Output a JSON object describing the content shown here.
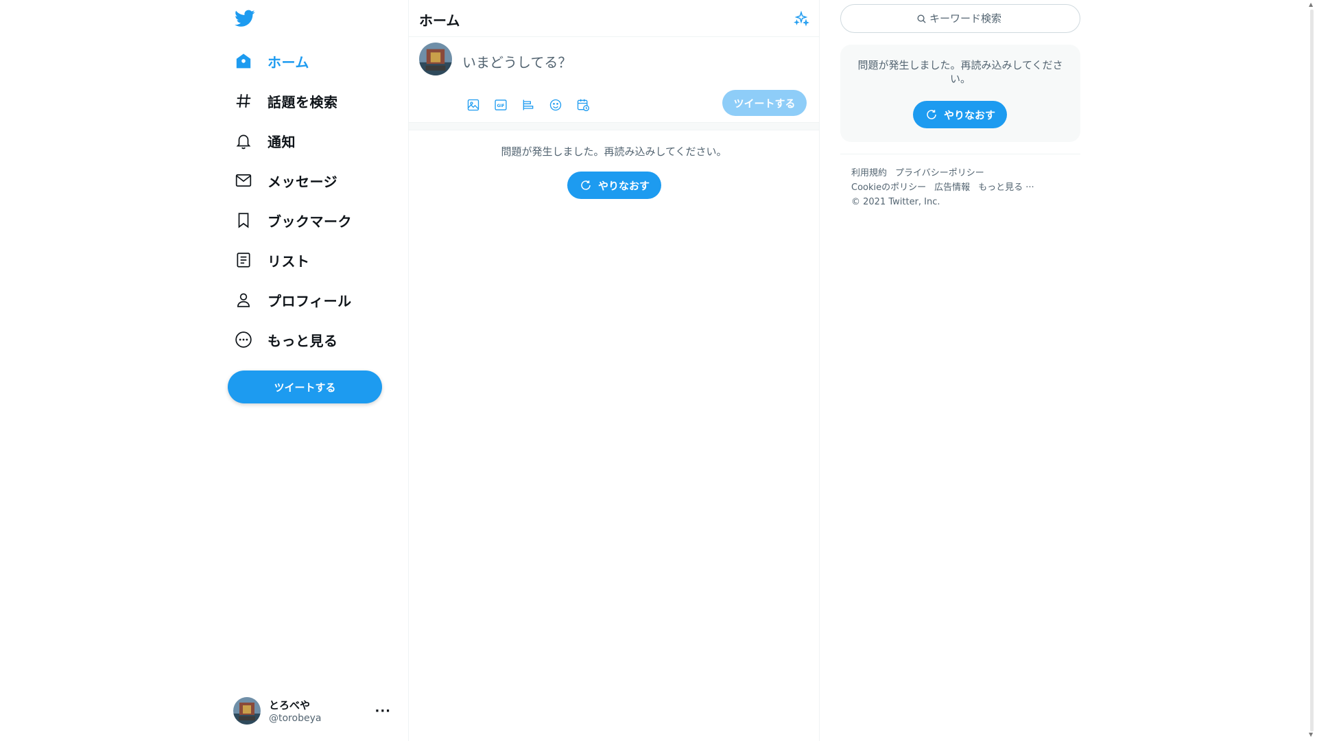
{
  "colors": {
    "accent": "#1d9bf0",
    "accent_disabled": "#8ecdf8",
    "text": "#0f1419",
    "muted": "#536471"
  },
  "sidebar": {
    "logo": "twitter-bird-icon",
    "items": [
      {
        "label": "ホーム",
        "icon": "home-icon",
        "active": true
      },
      {
        "label": "話題を検索",
        "icon": "hashtag-icon"
      },
      {
        "label": "通知",
        "icon": "bell-icon"
      },
      {
        "label": "メッセージ",
        "icon": "mail-icon"
      },
      {
        "label": "ブックマーク",
        "icon": "bookmark-icon"
      },
      {
        "label": "リスト",
        "icon": "list-icon"
      },
      {
        "label": "プロフィール",
        "icon": "person-icon"
      },
      {
        "label": "もっと見る",
        "icon": "more-circle-icon"
      }
    ],
    "tweet_button": "ツイートする",
    "account": {
      "display_name": "とろべや",
      "handle": "@torobeya",
      "more": "···"
    }
  },
  "main": {
    "title": "ホーム",
    "composer": {
      "placeholder": "いまどうしてる？",
      "tools": [
        "image-icon",
        "gif-icon",
        "poll-icon",
        "emoji-icon",
        "schedule-icon"
      ],
      "tweet_button": "ツイートする"
    },
    "error": {
      "message": "問題が発生しました。再読み込みしてください。",
      "retry": "やりなおす"
    }
  },
  "right": {
    "search_placeholder": "キーワード検索",
    "error": {
      "message": "問題が発生しました。再読み込みしてください。",
      "retry": "やりなおす"
    },
    "footer": {
      "links_row1": [
        "利用規約",
        "プライバシーポリシー"
      ],
      "links_row2": [
        "Cookieのポリシー",
        "広告情報",
        "もっと見る ···"
      ],
      "copyright": "© 2021 Twitter, Inc."
    }
  }
}
